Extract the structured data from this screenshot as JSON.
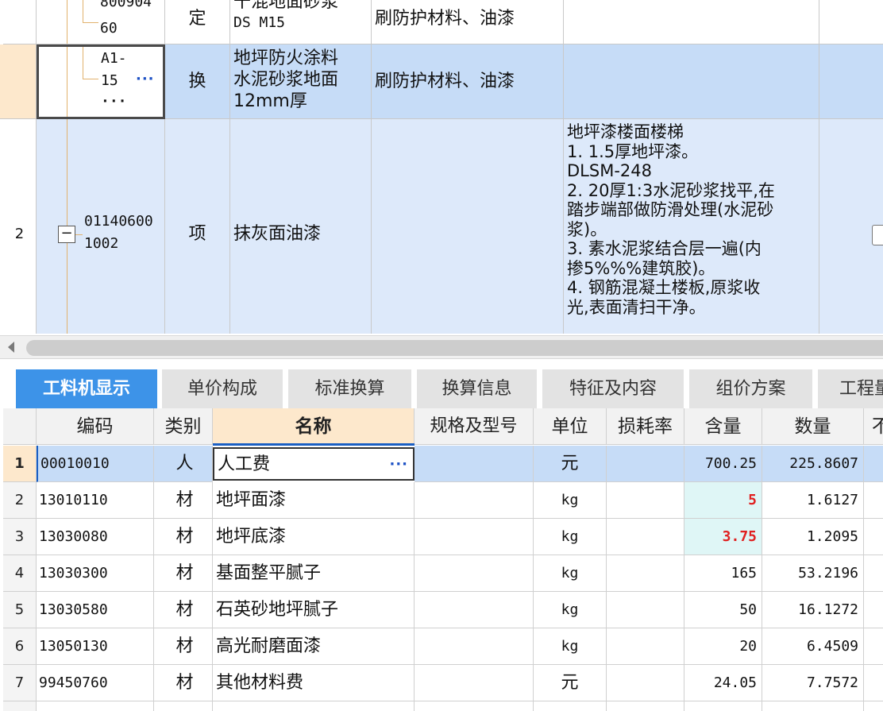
{
  "top_grid": {
    "row_prev": {
      "code_line1": "800904",
      "code_line2": "60",
      "type": "定",
      "name_line1": "干混地面砂浆",
      "name_line2": "DS M15",
      "category": "刷防护材料、油漆"
    },
    "row_sel": {
      "code_line1": "A1-",
      "code_line2": "15",
      "code_dots": "···",
      "code_line3": "···",
      "type": "换",
      "name_line1": "地坪防火涂料",
      "name_line2": "水泥砂浆地面",
      "name_line3": "12mm厚",
      "category": "刷防护材料、油漆"
    },
    "row_item": {
      "row_number": "2",
      "code_line1": "01140600",
      "code_line2": "1002",
      "type": "项",
      "name": "抹灰面油漆",
      "features": [
        "地坪漆楼面楼梯",
        "1.   1.5厚地坪漆。",
        "DLSM-248",
        "2.  20厚1:3水泥砂浆找平,在",
        "踏步端部做防滑处理(水泥砂",
        "浆)。",
        "3.  素水泥浆结合层一遍(内",
        "掺5%%%建筑胶)。",
        "4.  钢筋混凝土楼板,原浆收",
        "光,表面清扫干净。"
      ]
    }
  },
  "tabs": [
    {
      "label": "工料机显示",
      "active": true
    },
    {
      "label": "单价构成"
    },
    {
      "label": "标准换算"
    },
    {
      "label": "换算信息"
    },
    {
      "label": "特征及内容"
    },
    {
      "label": "组价方案"
    },
    {
      "label": "工程量"
    }
  ],
  "bottom_grid": {
    "headers": {
      "code": "编码",
      "category": "类别",
      "name": "名称",
      "spec": "规格及型号",
      "unit": "单位",
      "loss_rate": "损耗率",
      "content": "含量",
      "quantity": "数量",
      "extra": "不"
    },
    "rows": [
      {
        "n": "1",
        "code": "00010010",
        "category": "人",
        "name": "人工费",
        "name_dots": "···",
        "spec": "",
        "unit": "元",
        "loss_rate": "",
        "content": "700.25",
        "quantity": "225.8607"
      },
      {
        "n": "2",
        "code": "13010110",
        "category": "材",
        "name": "地坪面漆",
        "spec": "",
        "unit": "kg",
        "loss_rate": "",
        "content": "5",
        "quantity": "1.6127"
      },
      {
        "n": "3",
        "code": "13030080",
        "category": "材",
        "name": "地坪底漆",
        "spec": "",
        "unit": "kg",
        "loss_rate": "",
        "content": "3.75",
        "quantity": "1.2095"
      },
      {
        "n": "4",
        "code": "13030300",
        "category": "材",
        "name": "基面整平腻子",
        "spec": "",
        "unit": "kg",
        "loss_rate": "",
        "content": "165",
        "quantity": "53.2196"
      },
      {
        "n": "5",
        "code": "13030580",
        "category": "材",
        "name": "石英砂地坪腻子",
        "spec": "",
        "unit": "kg",
        "loss_rate": "",
        "content": "50",
        "quantity": "16.1272"
      },
      {
        "n": "6",
        "code": "13050130",
        "category": "材",
        "name": "高光耐磨面漆",
        "spec": "",
        "unit": "kg",
        "loss_rate": "",
        "content": "20",
        "quantity": "6.4509"
      },
      {
        "n": "7",
        "code": "99450760",
        "category": "材",
        "name": "其他材料费",
        "spec": "",
        "unit": "元",
        "loss_rate": "",
        "content": "24.05",
        "quantity": "7.7572"
      }
    ]
  },
  "colors": {
    "active_tab": "#3d93e8",
    "selected_row": "#c6dcf7",
    "edited_value": "#e02020",
    "edited_cell_bg": "#dff6f6",
    "row_header_selected": "#fde8cc"
  }
}
